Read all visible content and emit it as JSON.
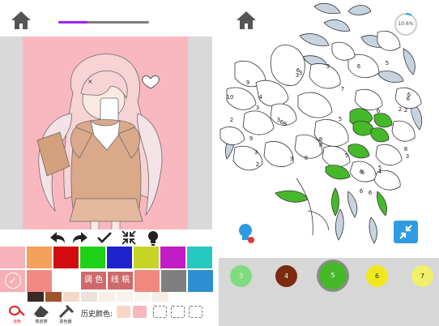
{
  "left": {
    "progress": 0.32,
    "toolbar": {
      "tools": [
        "undo-icon",
        "redo-icon",
        "check-icon",
        "shrink-icon",
        "bulb-icon"
      ]
    },
    "swatches_row1": [
      "#f7b2bc",
      "#f3a05a",
      "#d20c10",
      "#1fd218",
      "#1e23cf",
      "#c6d427",
      "#c21cc4",
      "#26c8c0"
    ],
    "swatches_row2": [
      "#f6b0b4",
      "#f08a83",
      "#cf6a6b",
      "#cf6a6b",
      "#f0887e",
      "#7f7f7f",
      "#2c8fd1"
    ],
    "swatches_row3": [
      "#3a2a26",
      "#a0542e",
      "#f4d9c6",
      "#ede2d8",
      "#f7efe9",
      "#f9f2ee",
      "#fbf6f2",
      "#f6ede6"
    ],
    "mix_label": "调 色",
    "draft_label": "线 稿",
    "bottom": {
      "fill_label": "涂色",
      "eraser_label": "橡皮擦",
      "picker_label": "取色器",
      "history_label": "历史颜色:",
      "history": [
        "#f7d6c6",
        "#f8b7bc"
      ]
    }
  },
  "right": {
    "percent": "10.6%",
    "leaf_numbers": [
      "6",
      "3",
      "6",
      "5",
      "9",
      "7",
      "3",
      "4",
      "10",
      "3",
      "6",
      "6",
      "3",
      "2",
      "6",
      "8",
      "3",
      "9",
      "2",
      "6",
      "8",
      "8",
      "3",
      "8",
      "3",
      "5",
      "5",
      "6",
      "6",
      "3",
      "5",
      "4",
      "6",
      "6",
      "2",
      "8",
      "2"
    ],
    "palette": [
      {
        "number": "3",
        "color": "#7edc7e",
        "text_color": "#e9f7e9"
      },
      {
        "number": "4",
        "color": "#7b2b10",
        "text_color": "#ffffff"
      },
      {
        "number": "5",
        "color": "#46b92a",
        "text_color": "#ffffff"
      },
      {
        "number": "6",
        "color": "#f0e81c",
        "text_color": "#2a2a2a"
      },
      {
        "number": "7",
        "color": "#f0f06a",
        "text_color": "#2a2a2a"
      }
    ]
  },
  "colors": {
    "home": "#555555",
    "fill_green": "#46b92a",
    "leaf_blue": "#c7d3df",
    "accent_blue": "#2f9be2"
  }
}
